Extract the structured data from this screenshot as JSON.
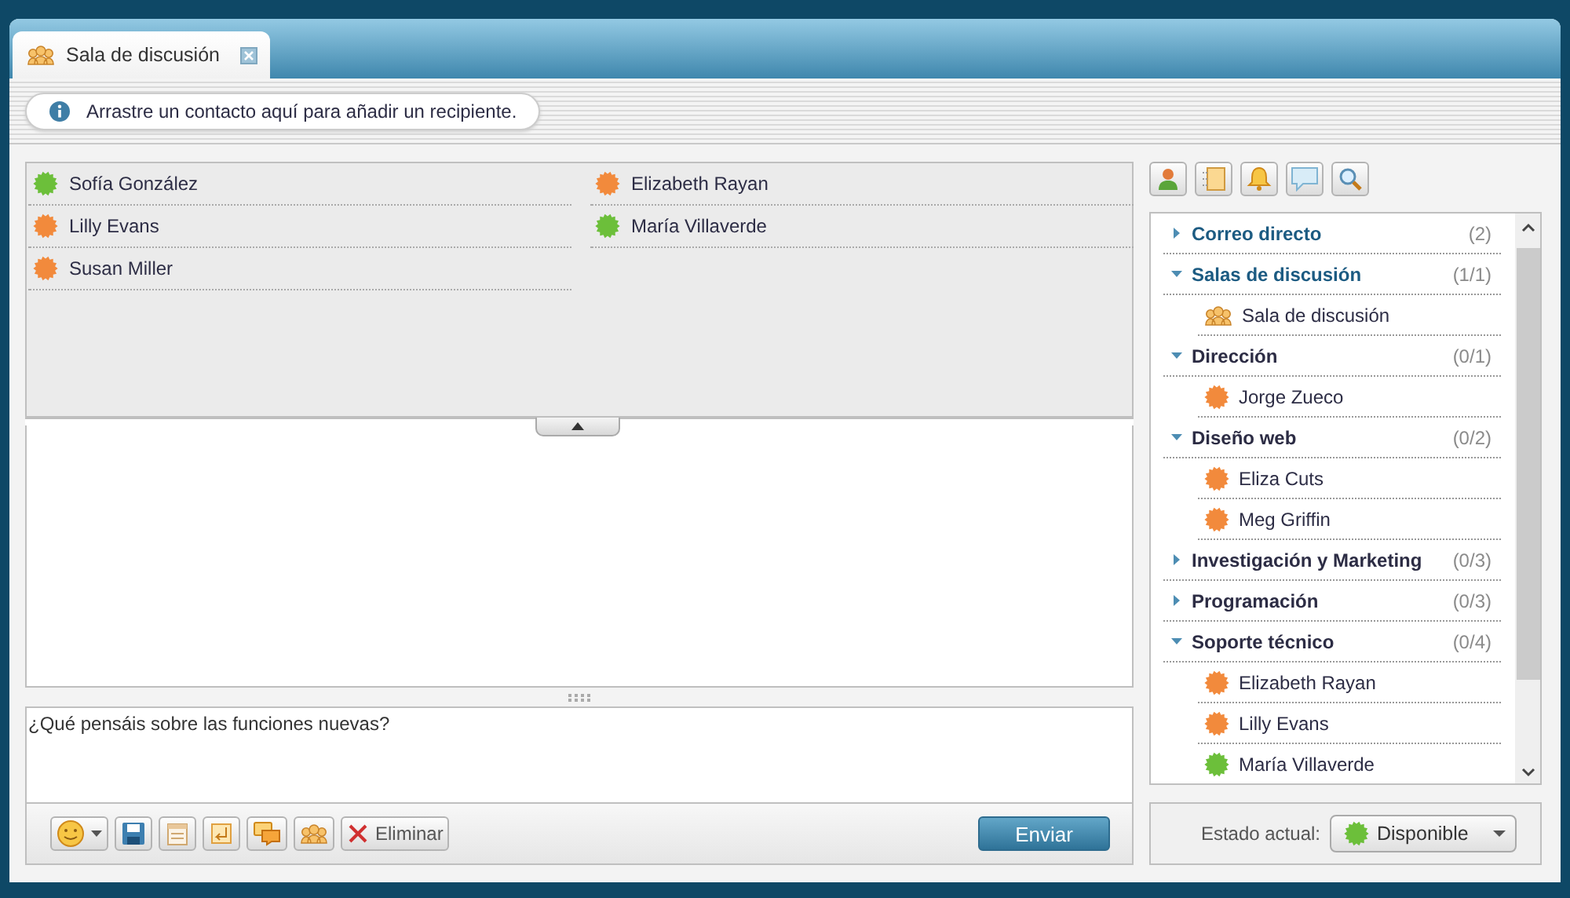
{
  "tab": {
    "title": "Sala de discusión",
    "selected": true
  },
  "info_bar": {
    "text": "Arrastre un contacto aquí para añadir un recipiente."
  },
  "recipients": [
    {
      "name": "Sofía González",
      "color": "#6cbf3a"
    },
    {
      "name": "Elizabeth Rayan",
      "color": "#f28a3c"
    },
    {
      "name": "Lilly Evans",
      "color": "#f28a3c"
    },
    {
      "name": "María Villaverde",
      "color": "#6cbf3a"
    },
    {
      "name": "Susan Miller",
      "color": "#f28a3c"
    }
  ],
  "composer": {
    "message": "¿Qué pensáis sobre las funciones nuevas?",
    "delete_label": "Eliminar",
    "send_label": "Enviar"
  },
  "side_panel": {
    "tree": [
      {
        "label": "Correo directo",
        "count": "(2)",
        "expanded": false,
        "highlighted": true
      },
      {
        "label": "Salas de discusión",
        "count": "(1/1)",
        "expanded": true,
        "highlighted": true,
        "children": [
          {
            "kind": "room",
            "name": "Sala de discusión"
          }
        ]
      },
      {
        "label": "Dirección",
        "count": "(0/1)",
        "expanded": true,
        "highlighted": false,
        "children": [
          {
            "kind": "contact",
            "name": "Jorge Zueco",
            "color": "#f28a3c"
          }
        ]
      },
      {
        "label": "Diseño web",
        "count": "(0/2)",
        "expanded": true,
        "highlighted": false,
        "children": [
          {
            "kind": "contact",
            "name": "Eliza Cuts",
            "color": "#f28a3c"
          },
          {
            "kind": "contact",
            "name": "Meg Griffin",
            "color": "#f28a3c"
          }
        ]
      },
      {
        "label": "Investigación y Marketing",
        "count": "(0/3)",
        "expanded": false,
        "highlighted": false
      },
      {
        "label": "Programación",
        "count": "(0/3)",
        "expanded": false,
        "highlighted": false
      },
      {
        "label": "Soporte técnico",
        "count": "(0/4)",
        "expanded": true,
        "highlighted": false,
        "children": [
          {
            "kind": "contact",
            "name": "Elizabeth Rayan",
            "color": "#f28a3c"
          },
          {
            "kind": "contact",
            "name": "Lilly Evans",
            "color": "#f28a3c"
          },
          {
            "kind": "contact",
            "name": "María Villaverde",
            "color": "#6cbf3a"
          }
        ]
      }
    ],
    "status": {
      "label": "Estado actual:",
      "value": "Disponible",
      "color": "#6cbf3a"
    }
  }
}
